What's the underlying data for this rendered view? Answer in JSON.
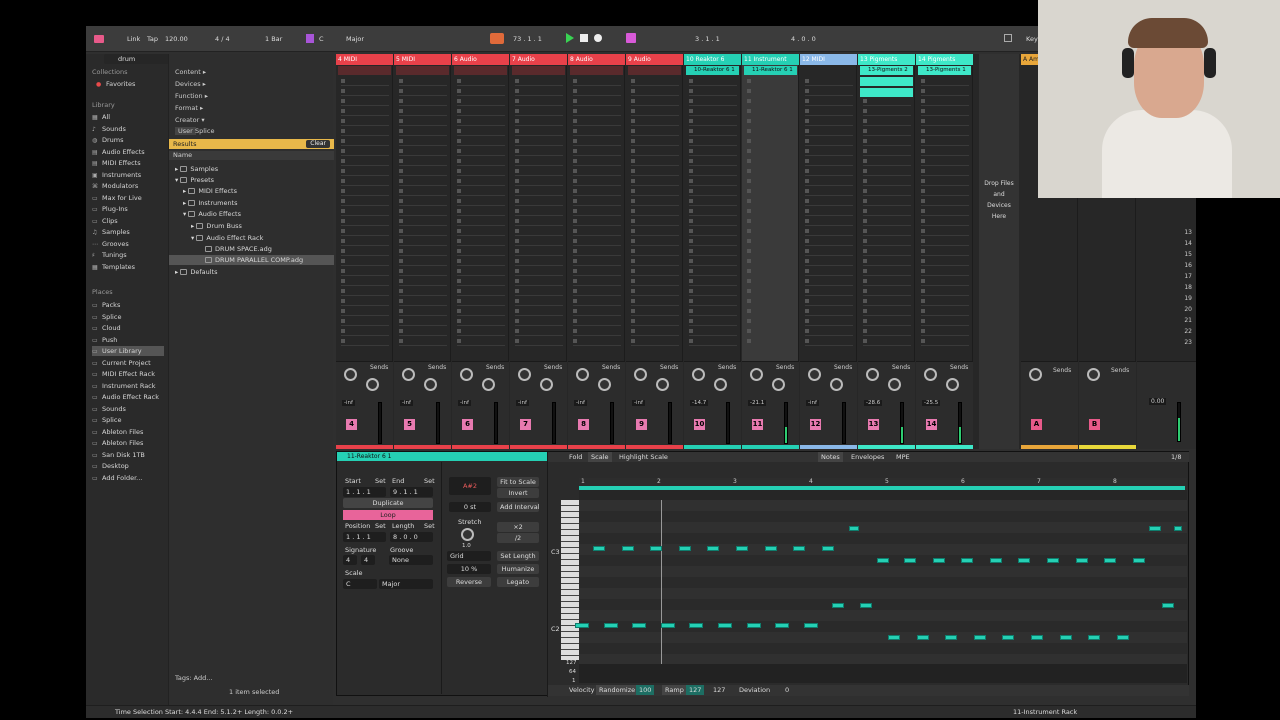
{
  "topbar": {
    "link": "Link",
    "tap": "Tap",
    "bpm": "120.00",
    "sig": "4 / 4",
    "quant": "1 Bar",
    "key": "C",
    "scale": "Major",
    "cpu": "73 .  1 .  1",
    "loop_start": "3 .  1 .  1",
    "loop_len": "4 .  0 .  0",
    "keys": "Key"
  },
  "browser": {
    "search": "drum",
    "collections": "Collections",
    "favorites": "Favorites",
    "library": "Library",
    "items": [
      "All",
      "Sounds",
      "Drums",
      "Audio Effects",
      "MIDI Effects",
      "Instruments",
      "Modulators",
      "Max for Live",
      "Plug-Ins",
      "Clips",
      "Samples",
      "Grooves",
      "Tunings",
      "Templates"
    ],
    "places": "Places",
    "place_items": [
      "Packs",
      "Splice",
      "Cloud",
      "Push",
      "User Library",
      "Current Project",
      "MIDI Effect Rack",
      "Instrument Rack",
      "Audio Effect Rack",
      "Sounds",
      "Splice",
      "Ableton Files",
      "Ableton Files",
      "San Disk 1TB",
      "Desktop",
      "Add Folder..."
    ]
  },
  "filters": {
    "content": "Content ▸",
    "devices": "Devices ▸",
    "function": "Function ▸",
    "format": "Format ▸",
    "creator": "Creator ▾",
    "user": "User",
    "splice": "Splice",
    "results": "Results",
    "clear": "Clear",
    "name": "Name"
  },
  "tree": [
    "Samples",
    "Presets",
    "MIDI Effects",
    "Instruments",
    "Audio Effects",
    "Drum Buss",
    "Audio Effect Rack",
    "DRUM SPACE.adg",
    "DRUM PARALLEL COMP.adg",
    "Defaults"
  ],
  "tags": "Tags:  Add...",
  "selected": "1 item selected",
  "tracks": [
    {
      "name": "4 MIDI",
      "color": "#e8414a",
      "num": "4",
      "clip": ""
    },
    {
      "name": "5 MIDI",
      "color": "#e8414a",
      "num": "5",
      "clip": ""
    },
    {
      "name": "6 Audio",
      "color": "#e8414a",
      "num": "6",
      "clip": ""
    },
    {
      "name": "7 Audio",
      "color": "#e8414a",
      "num": "7",
      "clip": ""
    },
    {
      "name": "8 Audio",
      "color": "#e8414a",
      "num": "8",
      "clip": ""
    },
    {
      "name": "9 Audio",
      "color": "#e8414a",
      "num": "9",
      "clip": ""
    },
    {
      "name": "10 Reaktor 6",
      "color": "#25d0b4",
      "num": "10",
      "clip": "10-Reaktor 6 1"
    },
    {
      "name": "11 Instrument",
      "color": "#25d0b4",
      "num": "11",
      "clip": "11-Reaktor 6 1"
    },
    {
      "name": "12 MIDI",
      "color": "#8ab8e8",
      "num": "12",
      "clip": ""
    },
    {
      "name": "13 Pigments",
      "color": "#3ee8c8",
      "num": "13",
      "clip": "13-Pigments 2"
    },
    {
      "name": "14 Pigments",
      "color": "#3ee8c8",
      "num": "14",
      "clip": "13-Pigments 1"
    }
  ],
  "drop": "Drop Files and Devices Here",
  "sends": "Sends",
  "volumes": [
    "-inf",
    "-inf",
    "-inf",
    "-inf",
    "-inf",
    "-inf",
    "-14.7",
    "-21.1",
    "-inf",
    "-28.6",
    "-25.5"
  ],
  "returns": [
    {
      "name": "A Am",
      "num": "A"
    },
    {
      "name": "",
      "num": "B"
    }
  ],
  "master_vol": "0.00",
  "scene_nums": [
    "13",
    "14",
    "15",
    "16",
    "17",
    "18",
    "19",
    "20",
    "21",
    "22",
    "23"
  ],
  "clip": {
    "title": "11-Reaktor 6 1",
    "start": "Start",
    "set": "Set",
    "end": "End",
    "start_val": "1 .  1 .  1",
    "end_val": "9 .  1 .  1",
    "duplicate": "Duplicate",
    "loop": "Loop",
    "position": "Position",
    "length": "Length",
    "pos_val": "1 .  1 .  1",
    "len_val": "8 .  0 .  0",
    "signature": "Signature",
    "groove": "Groove",
    "sig_n": "4",
    "sig_d": "4",
    "groove_val": "None",
    "scale": "Scale",
    "scale_key": "C",
    "scale_name": "Major"
  },
  "edit": {
    "note": "A#2",
    "fit": "Fit to Scale",
    "invert": "Invert",
    "pitch": "0 st",
    "add_interval": "Add Interval",
    "stretch": "Stretch",
    "x2": "×2",
    "d2": "/2",
    "stretch_val": "1.0",
    "grid": "Grid",
    "set_length": "Set Length",
    "pct": "10 %",
    "humanize": "Humanize",
    "reverse": "Reverse",
    "legato": "Legato"
  },
  "roll": {
    "fold": "Fold",
    "scale": "Scale",
    "highlight": "Highlight Scale",
    "notes": "Notes",
    "envelopes": "Envelopes",
    "mpe": "MPE",
    "grid": "1/8",
    "bars": [
      "1",
      "2",
      "3",
      "4",
      "5",
      "6",
      "7",
      "8"
    ],
    "c3": "C3",
    "c2": "C2",
    "vel_top": "127",
    "vel_mid": "64",
    "vel_low": "1"
  },
  "footer": {
    "velocity": "Velocity",
    "randomize": "Randomize",
    "rand_val": "100",
    "ramp": "Ramp",
    "ramp_a": "127",
    "ramp_b": "127",
    "deviation": "Deviation",
    "dev_val": "0"
  },
  "status": {
    "text": "Time Selection   Start: 4.4.4   End: 5.1.2+   Length: 0.0.2+",
    "track": "11-Instrument Rack"
  }
}
